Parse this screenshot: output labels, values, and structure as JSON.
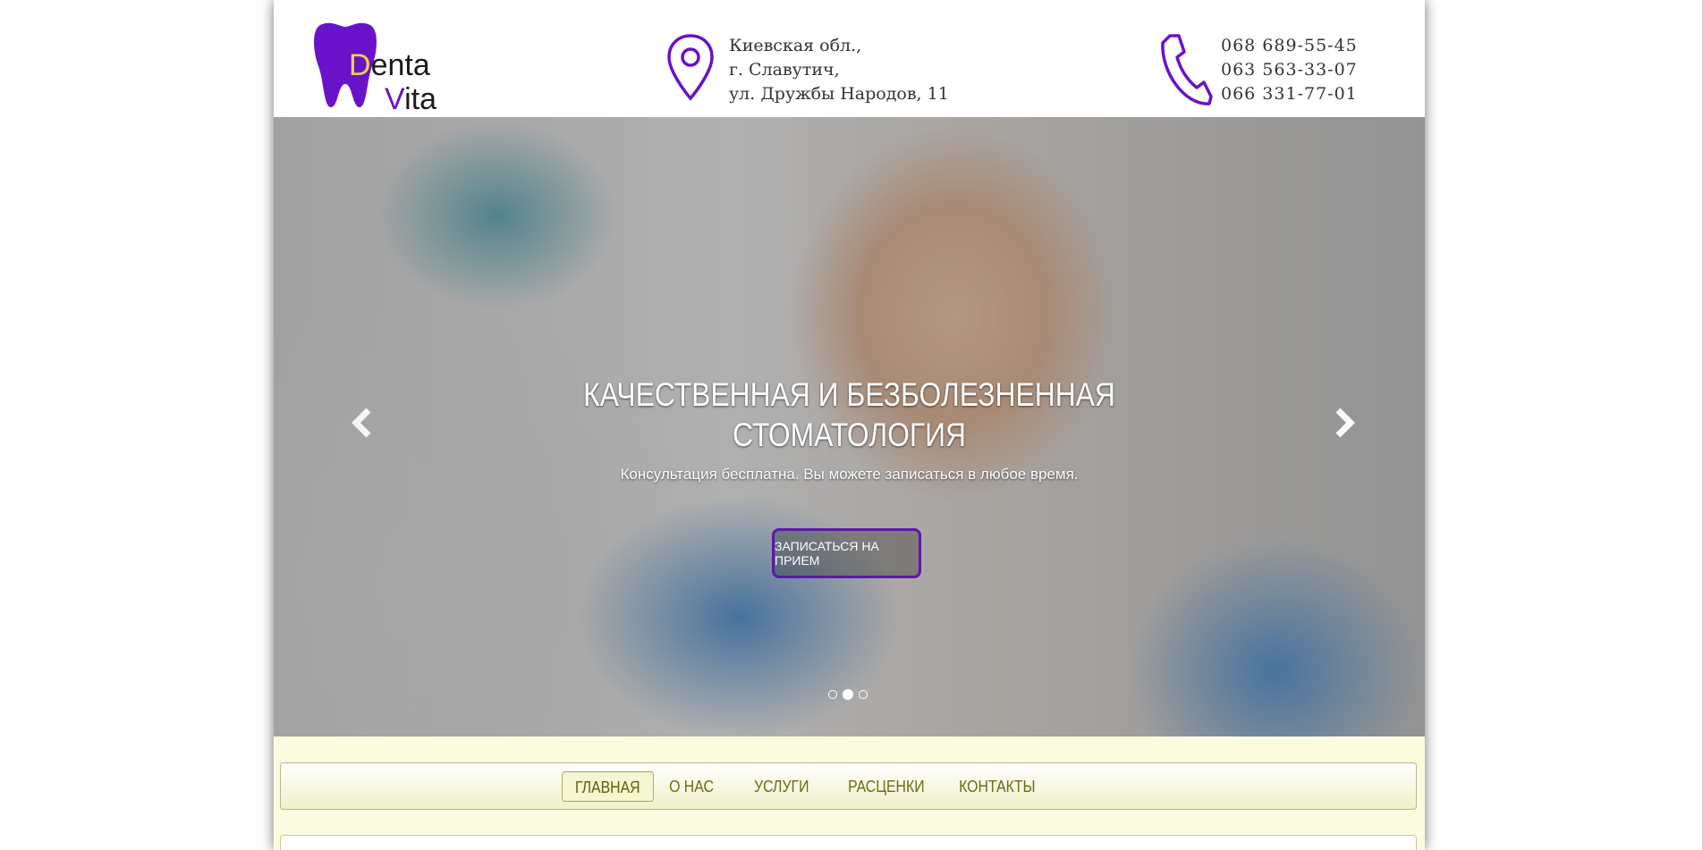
{
  "brand": {
    "part1_initial": "D",
    "part1_rest": "enta",
    "part2_initial": "V",
    "part2_rest": "ita"
  },
  "address": {
    "lines": [
      "Киевская обл.,",
      "г. Славутич,",
      "ул. Дружбы Народов, 11"
    ],
    "icon": "map-pin-icon"
  },
  "phones": {
    "lines": [
      "068 689-55-45",
      "063 563-33-07",
      "066 331-77-01"
    ],
    "icon": "phone-icon"
  },
  "hero": {
    "title_line1": "КАЧЕСТВЕННАЯ И БЕЗБОЛЕЗНЕННАЯ",
    "title_line2": "СТОМАТОЛОГИЯ",
    "subtitle": "Консультация бесплатна. Вы можете записаться в любое время.",
    "cta": "ЗАПИСАТЬСЯ НА ПРИЕМ",
    "slides": 3,
    "active_slide": 2
  },
  "nav": {
    "items": [
      "ГЛАВНАЯ",
      "О НАС",
      "УСЛУГИ",
      "РАСЦЕНКИ",
      "КОНТАКТЫ"
    ],
    "active_index": 0
  },
  "colors": {
    "brand_purple": "#6a12c9",
    "brand_yellow": "#e8d44a",
    "nav_text": "#6b6a14",
    "nav_bg": "#fbfbdf"
  }
}
